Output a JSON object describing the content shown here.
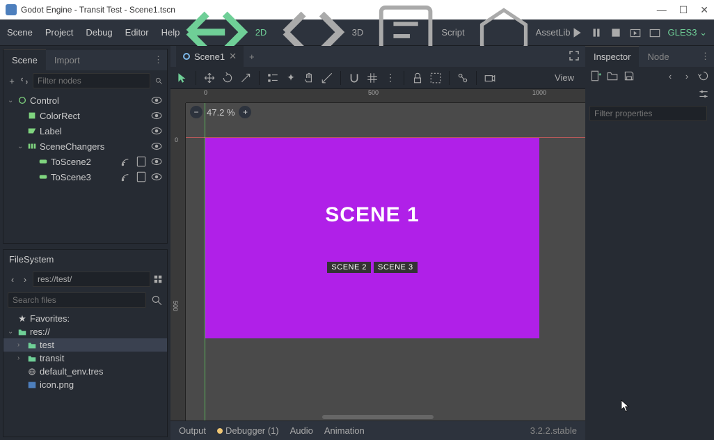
{
  "window": {
    "title": "Godot Engine - Transit Test - Scene1.tscn"
  },
  "menubar": {
    "scene": "Scene",
    "project": "Project",
    "debug": "Debug",
    "editor": "Editor",
    "help": "Help",
    "ws_2d": "2D",
    "ws_3d": "3D",
    "ws_script": "Script",
    "ws_assetlib": "AssetLib",
    "gles": "GLES3"
  },
  "scene_panel": {
    "tab_scene": "Scene",
    "tab_import": "Import",
    "filter_placeholder": "Filter nodes",
    "nodes": {
      "control": "Control",
      "colorrect": "ColorRect",
      "label": "Label",
      "changers": "SceneChangers",
      "toscene2": "ToScene2",
      "toscene3": "ToScene3"
    }
  },
  "filesystem": {
    "title": "FileSystem",
    "path": "res://test/",
    "search_placeholder": "Search files",
    "favorites": "Favorites:",
    "root": "res://",
    "items": {
      "test": "test",
      "transit": "transit",
      "default_env": "default_env.tres",
      "icon": "icon.png"
    }
  },
  "scene_tabs": {
    "scene1": "Scene1"
  },
  "canvas": {
    "zoom": "47.2 %",
    "view": "View",
    "ruler": {
      "r0": "0",
      "r500": "500",
      "r1000": "1000",
      "v0": "0",
      "v500": "500"
    },
    "scene_label": "SCENE 1",
    "btn_scene2": "SCENE 2",
    "btn_scene3": "SCENE 3"
  },
  "bottom": {
    "output": "Output",
    "debugger": "Debugger (1)",
    "audio": "Audio",
    "animation": "Animation",
    "version": "3.2.2.stable"
  },
  "inspector": {
    "tab_inspector": "Inspector",
    "tab_node": "Node",
    "filter_placeholder": "Filter properties"
  }
}
